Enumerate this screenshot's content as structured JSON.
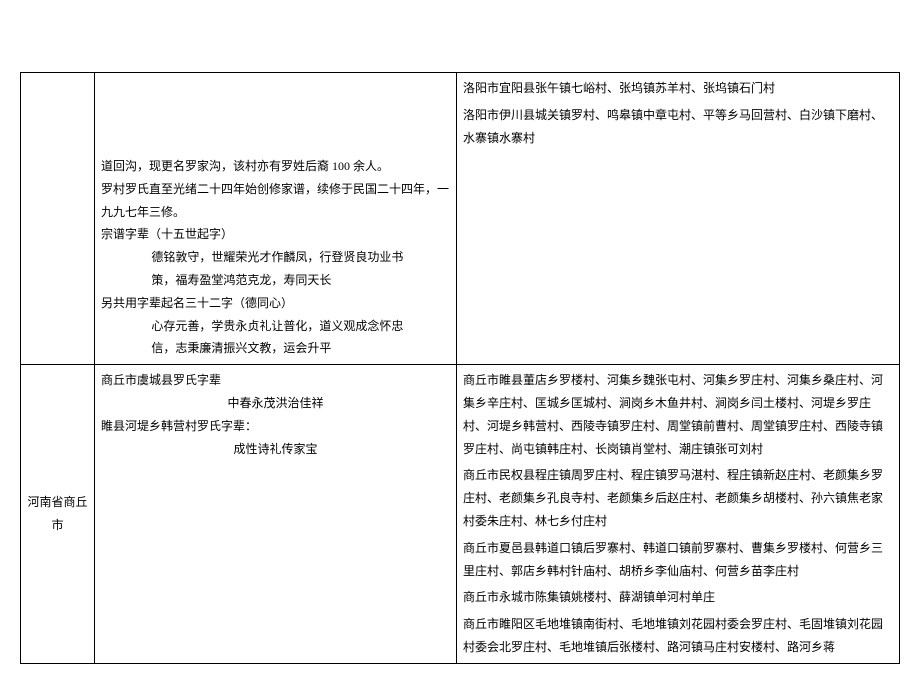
{
  "row1": {
    "left": "",
    "mid": {
      "l1": "道回沟，现更名罗家沟，该村亦有罗姓后裔 100 余人。",
      "l2": "罗村罗氏直至光绪二十四年始创修家谱，续修于民国二十四年，一九九七年三修。",
      "l3": "宗谱字辈（十五世起字）",
      "l4a": "德铭敦守，世耀荣光才作麟凤，行登贤良功业书",
      "l4b": "策，福寿盈堂鸿范克龙，寿同天长",
      "l5": "另共用字辈起名三十二字（德同心）",
      "l6a": "心存元善，学贵永贞礼让普化，道义观成念怀忠",
      "l6b": "信，志秉廉清振兴文教，运会升平"
    },
    "right": {
      "l1": "洛阳市宜阳县张午镇七峪村、张坞镇苏羊村、张坞镇石门村",
      "l2": "洛阳市伊川县城关镇罗村、鸣皋镇中章屯村、平等乡马回营村、白沙镇下磨村、水寨镇水寨村"
    }
  },
  "row2": {
    "left": "河南省商丘市",
    "mid": {
      "l1": "商丘市虞城县罗氏字辈",
      "l2": "中春永茂洪治佳祥",
      "l3": "睢县河堤乡韩营村罗氏字辈：",
      "l4": "成性诗礼传家宝"
    },
    "right": {
      "l1": "商丘市睢县董店乡罗楼村、河集乡魏张屯村、河集乡罗庄村、河集乡桑庄村、河集乡辛庄村、匡城乡匡城村、涧岗乡木鱼井村、涧岗乡闫土楼村、河堤乡罗庄村、河堤乡韩营村、西陵寺镇罗庄村、周堂镇前曹村、周堂镇罗庄村、西陵寺镇罗庄村、尚屯镇韩庄村、长岗镇肖堂村、潮庄镇张可刘村",
      "l2": "商丘市民权县程庄镇周罗庄村、程庄镇罗马湛村、程庄镇新赵庄村、老颜集乡罗庄村、老颜集乡孔良寺村、老颜集乡后赵庄村、老颜集乡胡楼村、孙六镇焦老家村委朱庄村、林七乡付庄村",
      "l3": "商丘市夏邑县韩道口镇后罗寨村、韩道口镇前罗寨村、曹集乡罗楼村、何营乡三里庄村、郭店乡韩村针庙村、胡桥乡李仙庙村、何营乡苗李庄村",
      "l4": "商丘市永城市陈集镇姚楼村、薛湖镇单河村单庄",
      "l5": "商丘市睢阳区毛地堆镇南街村、毛地堆镇刘花园村委会罗庄村、毛固堆镇刘花园村委会北罗庄村、毛地堆镇后张楼村、路河镇马庄村安楼村、路河乡蒋"
    }
  }
}
